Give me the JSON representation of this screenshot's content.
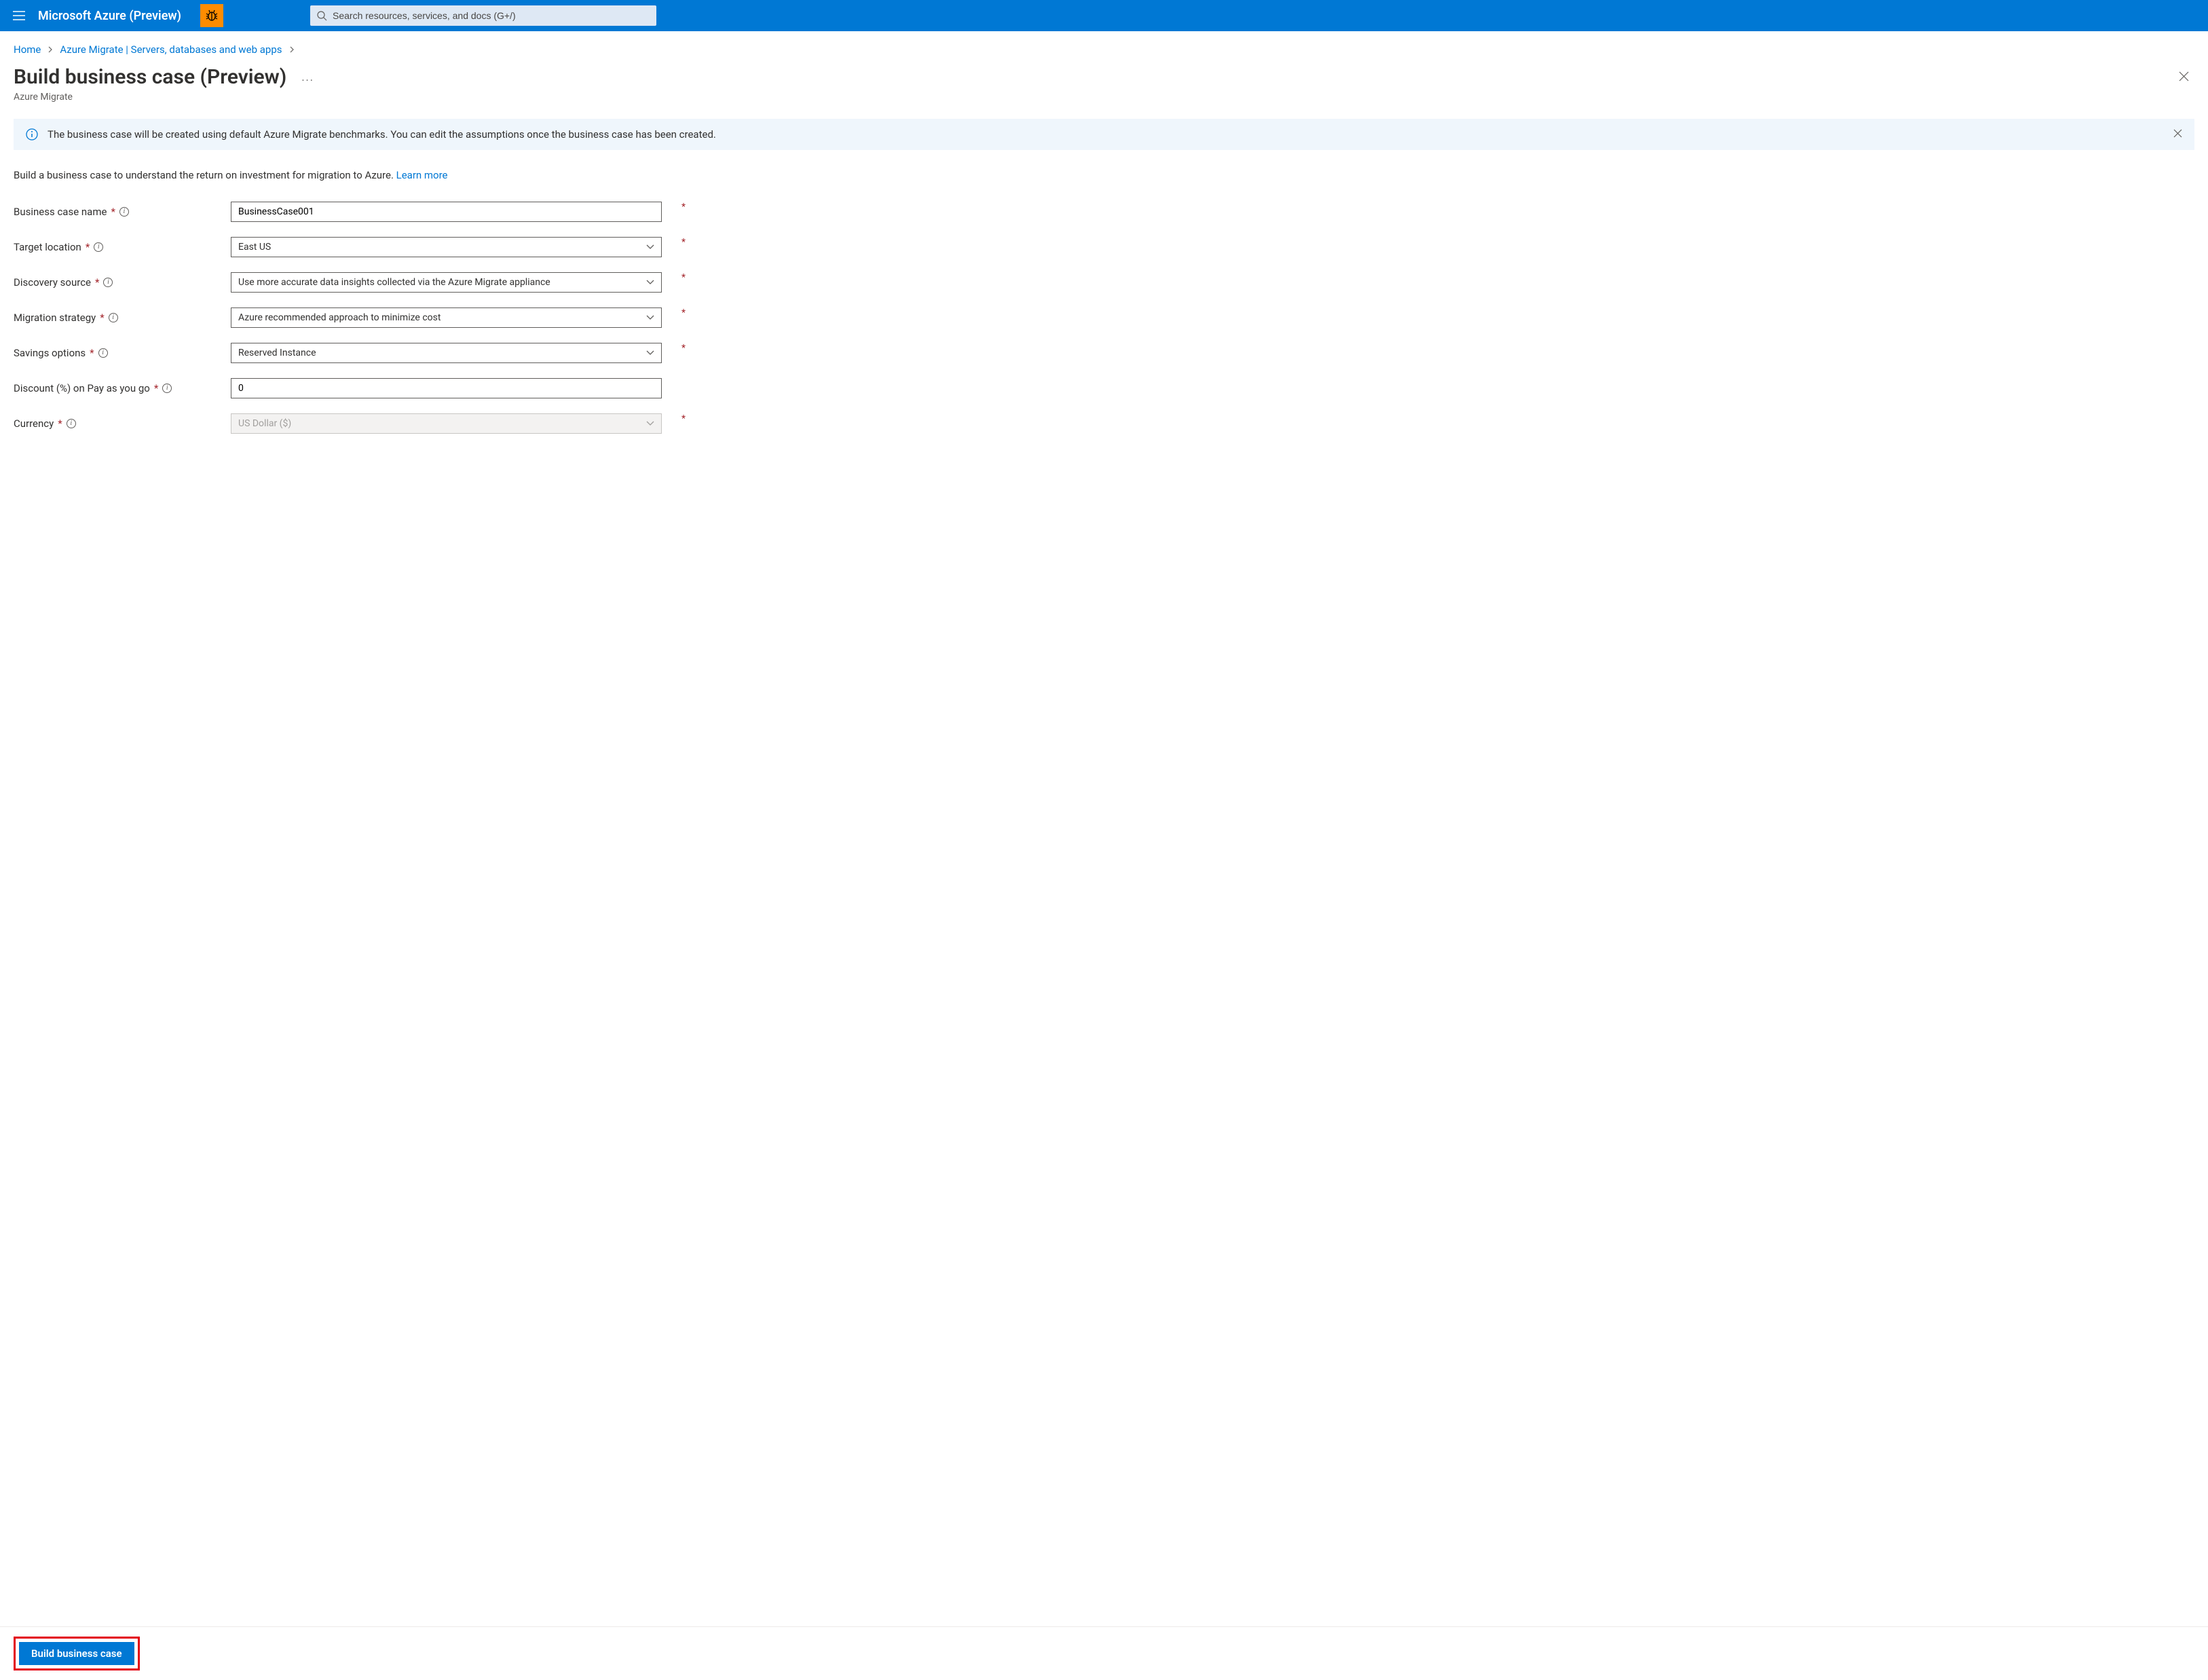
{
  "header": {
    "brand": "Microsoft Azure (Preview)",
    "search_placeholder": "Search resources, services, and docs (G+/)"
  },
  "breadcrumb": {
    "home": "Home",
    "item1": "Azure Migrate | Servers, databases and web apps"
  },
  "page": {
    "title": "Build business case (Preview)",
    "subtitle": "Azure Migrate"
  },
  "banner": {
    "text": "The business case will be created using default Azure Migrate benchmarks. You can edit the assumptions once the business case has been created."
  },
  "intro": {
    "text": "Build a business case to understand the return on investment for migration to Azure. ",
    "link": "Learn more"
  },
  "form": {
    "business_case_name": {
      "label": "Business case name",
      "value": "BusinessCase001"
    },
    "target_location": {
      "label": "Target location",
      "value": "East US"
    },
    "discovery_source": {
      "label": "Discovery source",
      "value": "Use more accurate data insights collected via the Azure Migrate appliance"
    },
    "migration_strategy": {
      "label": "Migration strategy",
      "value": "Azure recommended approach to minimize cost"
    },
    "savings_options": {
      "label": "Savings options",
      "value": "Reserved Instance"
    },
    "discount": {
      "label": "Discount (%) on Pay as you go",
      "value": "0"
    },
    "currency": {
      "label": "Currency",
      "value": "US Dollar ($)"
    }
  },
  "footer": {
    "submit": "Build business case"
  }
}
